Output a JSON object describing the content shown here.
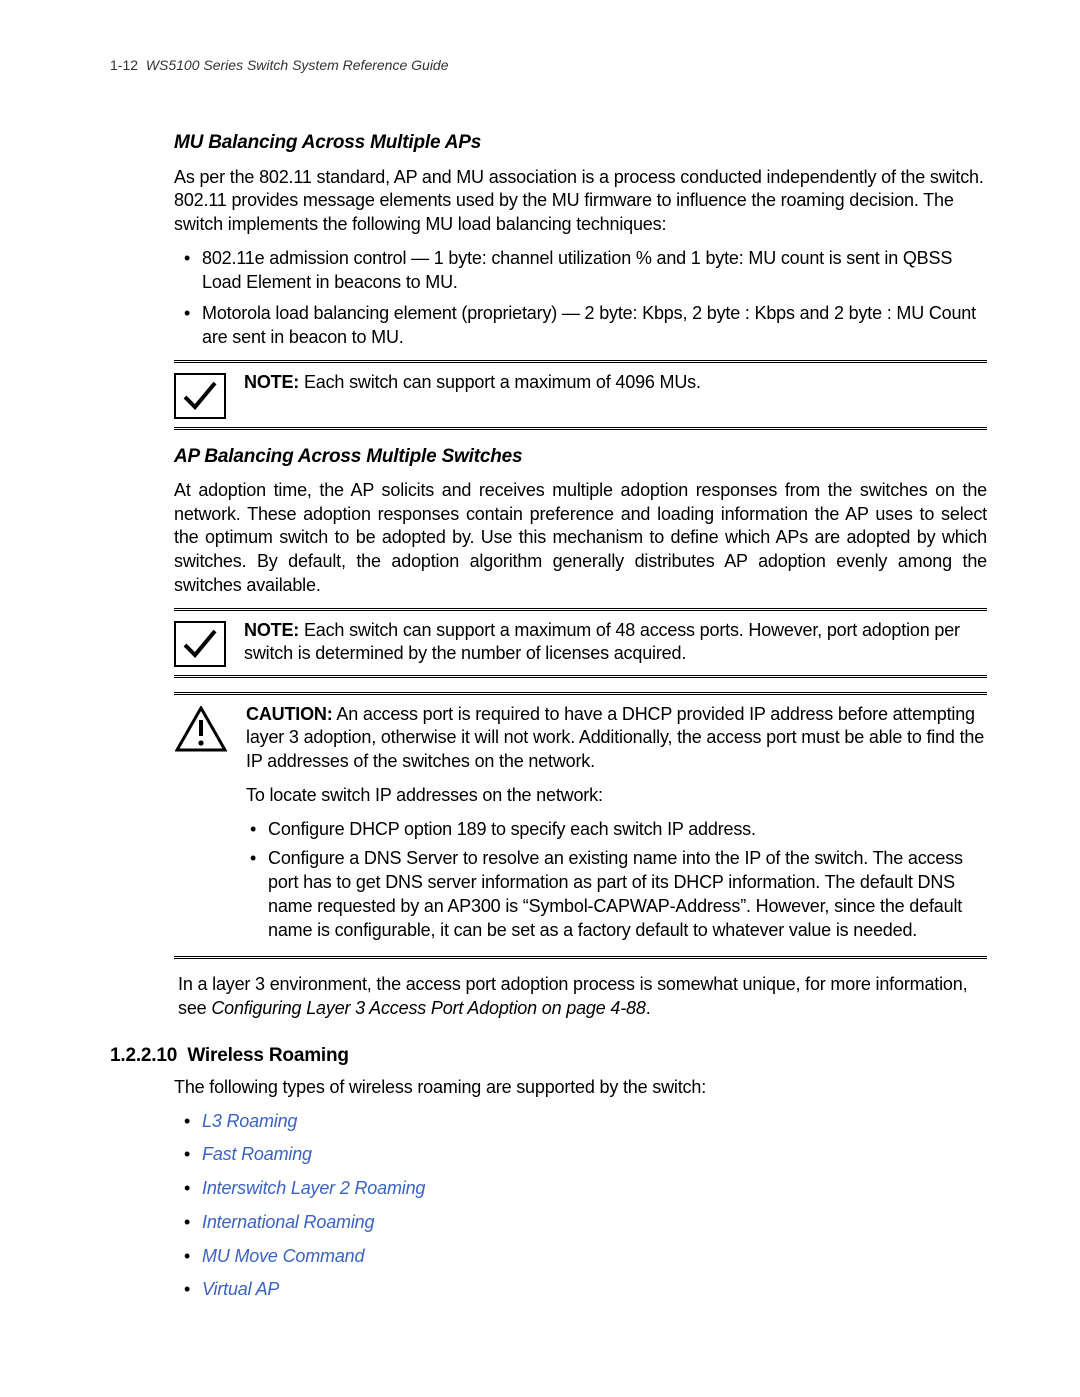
{
  "header": {
    "page_num": "1-12",
    "doc_title": "WS5100 Series Switch System Reference Guide"
  },
  "sec1": {
    "heading": "MU Balancing Across Multiple APs",
    "p1": "As per the 802.11 standard, AP and MU association is a process conducted independently of the switch. 802.11 provides message elements used by the MU firmware to influence the roaming decision. The switch implements the following MU load balancing techniques:",
    "b1": "802.11e admission control — 1 byte: channel utilization % and 1 byte: MU count is sent in QBSS Load Element in beacons to MU.",
    "b2": "Motorola load balancing element (proprietary) — 2 byte: Kbps, 2 byte : Kbps and 2 byte : MU Count are sent in beacon to MU.",
    "note_label": "NOTE:",
    "note": "Each switch can support a maximum of 4096 MUs."
  },
  "sec2": {
    "heading": "AP Balancing Across Multiple Switches",
    "p1": "At adoption time, the AP solicits and receives multiple adoption responses from the switches on the network. These adoption responses contain preference and loading information the AP uses to select the optimum switch to be adopted by. Use this mechanism to define which APs are adopted by which switches. By default, the adoption algorithm generally distributes AP adoption evenly among the switches available.",
    "note_label": "NOTE:",
    "note": "Each switch can support a maximum of 48 access ports. However, port adoption per switch is determined by the number of licenses acquired.",
    "caution_label": "CAUTION:",
    "caution": "An access port is required to have a DHCP provided IP address before attempting layer 3 adoption, otherwise it will not work. Additionally, the access port must be able to find the IP addresses of the switches on the network.",
    "locate": "To locate switch IP addresses on the network:",
    "lb1": "Configure DHCP option 189 to specify each switch IP address.",
    "lb2": "Configure a DNS Server to resolve an existing name into the IP of the switch. The access port has to get DNS server information as part of its DHCP information. The default DNS name requested by an AP300 is “Symbol-CAPWAP-Address”. However, since the default name is configurable, it can be set as a factory default to whatever value is needed.",
    "after1": "In a layer 3 environment, the access port adoption process is somewhat unique, for more information, see ",
    "after1_ref": "Configuring Layer 3 Access Port Adoption on page 4-88",
    "after1_end": "."
  },
  "sec3": {
    "num": "1.2.2.10",
    "title": "Wireless Roaming",
    "p1": "The following types of wireless roaming are supported by the switch:",
    "links": {
      "l1": "L3 Roaming",
      "l2": "Fast Roaming",
      "l3": "Interswitch Layer 2 Roaming",
      "l4": "International Roaming",
      "l5": "MU Move Command",
      "l6": "Virtual AP"
    }
  }
}
